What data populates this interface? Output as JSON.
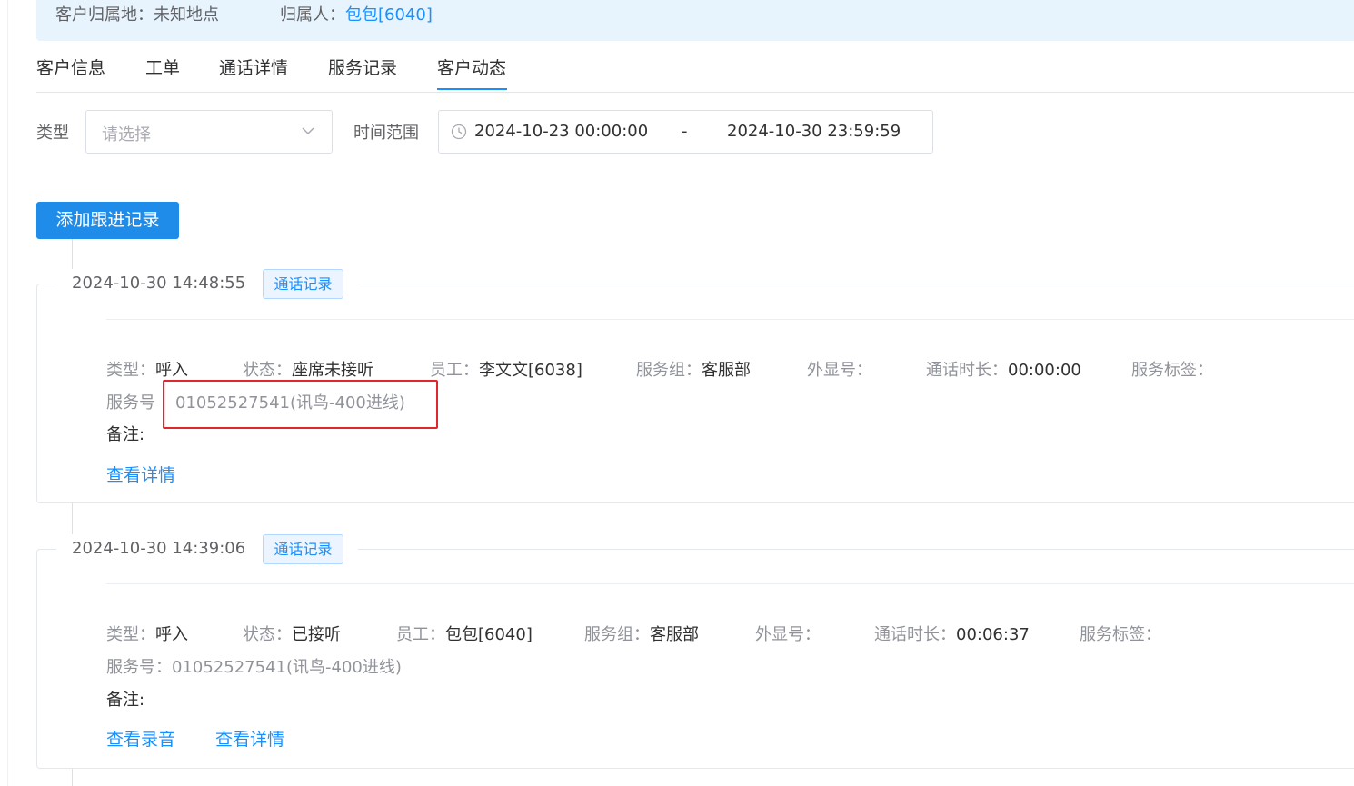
{
  "header": {
    "location_label": "客户归属地：",
    "location_value": "未知地点",
    "owner_label": "归属人：",
    "owner_value": "包包[6040]"
  },
  "tabs": [
    {
      "label": "客户信息"
    },
    {
      "label": "工单"
    },
    {
      "label": "通话详情"
    },
    {
      "label": "服务记录"
    },
    {
      "label": "客户动态",
      "active": true
    }
  ],
  "filters": {
    "type_label": "类型",
    "type_placeholder": "请选择",
    "range_label": "时间范围",
    "start": "2024-10-23 00:00:00",
    "separator": "-",
    "end": "2024-10-30 23:59:59"
  },
  "add_button": "添加跟进记录",
  "records": [
    {
      "time": "2024-10-30 14:48:55",
      "tag": "通话记录",
      "type_label": "类型：",
      "type_value": "呼入",
      "status_label": "状态：",
      "status_value": "座席未接听",
      "staff_label": "员工：",
      "staff_value": "李文文[6038]",
      "group_label": "服务组：",
      "group_value": "客服部",
      "display_label": "外显号：",
      "duration_label": "通话时长：",
      "duration_value": "00:00:00",
      "tag_label": "服务标签：",
      "service_label": "服务号",
      "service_value": "01052527541(讯鸟-400进线)",
      "remark_label": "备注:",
      "links": [
        "查看详情"
      ]
    },
    {
      "time": "2024-10-30 14:39:06",
      "tag": "通话记录",
      "type_label": "类型：",
      "type_value": "呼入",
      "status_label": "状态：",
      "status_value": "已接听",
      "staff_label": "员工：",
      "staff_value": "包包[6040]",
      "group_label": "服务组：",
      "group_value": "客服部",
      "display_label": "外显号：",
      "duration_label": "通话时长：",
      "duration_value": "00:06:37",
      "tag_label": "服务标签：",
      "service_label": "服务号：",
      "service_value": "01052527541(讯鸟-400进线)",
      "remark_label": "备注:",
      "links": [
        "查看录音",
        "查看详情"
      ]
    }
  ],
  "colors": {
    "accent": "#1890ff",
    "button": "#1e8ce8",
    "highlight_box": "#e0272b",
    "info_bg": "#e8f4fd"
  },
  "icons": {
    "select_caret": "chevron-down-icon",
    "date_prefix": "clock-icon"
  }
}
